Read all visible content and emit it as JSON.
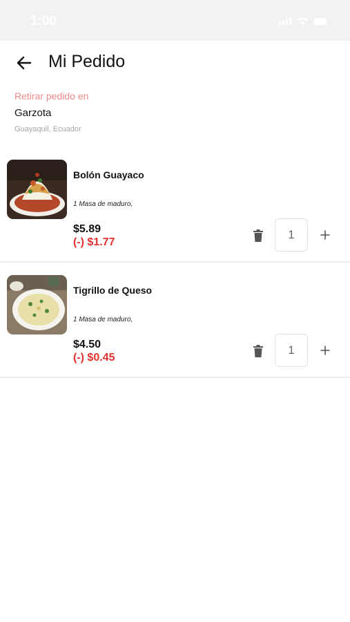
{
  "status_bar": {
    "time": "1:00"
  },
  "header": {
    "title": "Mi Pedido"
  },
  "pickup": {
    "label": "Retirar pedido en",
    "store": "Garzota",
    "location": "Guayaquil, Ecuador"
  },
  "items": [
    {
      "name": "Bolón Guayaco",
      "note": "1 Masa de maduro,",
      "price": "$5.89",
      "discount": "(-) $1.77",
      "quantity": "1",
      "image_icon": "bolon-photo"
    },
    {
      "name": "Tigrillo de Queso",
      "note": "1 Masa de maduro,",
      "price": "$4.50",
      "discount": "(-) $0.45",
      "quantity": "1",
      "image_icon": "tigrillo-photo"
    }
  ],
  "colors": {
    "accent_pink": "#f08a8a",
    "discount_red": "#e53030",
    "divider": "#ececec"
  }
}
